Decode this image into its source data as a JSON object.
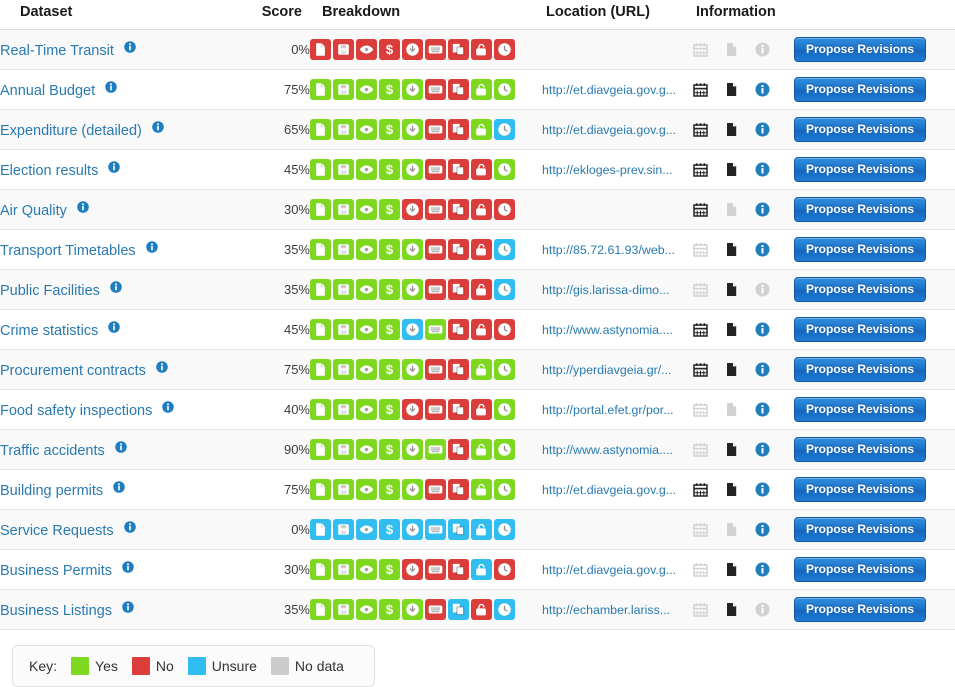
{
  "table": {
    "columns": [
      {
        "key": "dataset",
        "label": "Dataset"
      },
      {
        "key": "score",
        "label": "Score"
      },
      {
        "key": "breakdown",
        "label": "Breakdown"
      },
      {
        "key": "url",
        "label": "Location (URL)"
      },
      {
        "key": "information",
        "label": "Information"
      },
      {
        "key": "action",
        "label": ""
      }
    ],
    "action_label": "Propose Revisions",
    "breakdown_icon_names": [
      "file-icon",
      "floppy-disk-icon",
      "eye-icon",
      "dollar-icon",
      "download-icon",
      "keyboard-icon",
      "copy-icon",
      "unlock-icon",
      "clock-icon"
    ],
    "information_icon_names": [
      "calendar-icon",
      "document-icon",
      "info-circle-icon"
    ],
    "rows": [
      {
        "dataset": "Real-Time Transit",
        "score": "0%",
        "breakdown": [
          "no",
          "no",
          "no",
          "no",
          "no",
          "no",
          "no",
          "no",
          "no"
        ],
        "url": "",
        "information": [
          "off",
          "off",
          "off"
        ]
      },
      {
        "dataset": "Annual Budget",
        "score": "75%",
        "breakdown": [
          "yes",
          "yes",
          "yes",
          "yes",
          "yes",
          "no",
          "no",
          "yes",
          "yes"
        ],
        "url": "http://et.diavgeia.gov.g...",
        "information": [
          "on",
          "on",
          "on"
        ]
      },
      {
        "dataset": "Expenditure (detailed)",
        "score": "65%",
        "breakdown": [
          "yes",
          "yes",
          "yes",
          "yes",
          "yes",
          "no",
          "no",
          "yes",
          "unsure"
        ],
        "url": "http://et.diavgeia.gov.g...",
        "information": [
          "on",
          "on",
          "on"
        ]
      },
      {
        "dataset": "Election results",
        "score": "45%",
        "breakdown": [
          "yes",
          "yes",
          "yes",
          "yes",
          "yes",
          "no",
          "no",
          "no",
          "yes"
        ],
        "url": "http://ekloges-prev.sin...",
        "information": [
          "on",
          "on",
          "on"
        ]
      },
      {
        "dataset": "Air Quality",
        "score": "30%",
        "breakdown": [
          "yes",
          "yes",
          "yes",
          "yes",
          "no",
          "no",
          "no",
          "no",
          "no"
        ],
        "url": "",
        "information": [
          "on",
          "off",
          "on"
        ]
      },
      {
        "dataset": "Transport Timetables",
        "score": "35%",
        "breakdown": [
          "yes",
          "yes",
          "yes",
          "yes",
          "yes",
          "no",
          "no",
          "no",
          "unsure"
        ],
        "url": "http://85.72.61.93/web...",
        "information": [
          "off",
          "on",
          "on"
        ]
      },
      {
        "dataset": "Public Facilities",
        "score": "35%",
        "breakdown": [
          "yes",
          "yes",
          "yes",
          "yes",
          "yes",
          "no",
          "no",
          "no",
          "unsure"
        ],
        "url": "http://gis.larissa-dimo...",
        "information": [
          "off",
          "on",
          "off"
        ]
      },
      {
        "dataset": "Crime statistics",
        "score": "45%",
        "breakdown": [
          "yes",
          "yes",
          "yes",
          "yes",
          "unsure",
          "yes",
          "no",
          "no",
          "no"
        ],
        "url": "http://www.astynomia....",
        "information": [
          "on",
          "on",
          "on"
        ]
      },
      {
        "dataset": "Procurement contracts",
        "score": "75%",
        "breakdown": [
          "yes",
          "yes",
          "yes",
          "yes",
          "yes",
          "no",
          "no",
          "yes",
          "yes"
        ],
        "url": "http://yperdiavgeia.gr/...",
        "information": [
          "on",
          "on",
          "on"
        ]
      },
      {
        "dataset": "Food safety inspections",
        "score": "40%",
        "breakdown": [
          "yes",
          "yes",
          "yes",
          "yes",
          "no",
          "no",
          "no",
          "no",
          "yes"
        ],
        "url": "http://portal.efet.gr/por...",
        "information": [
          "off",
          "off",
          "on"
        ]
      },
      {
        "dataset": "Traffic accidents",
        "score": "90%",
        "breakdown": [
          "yes",
          "yes",
          "yes",
          "yes",
          "yes",
          "yes",
          "no",
          "yes",
          "yes"
        ],
        "url": "http://www.astynomia....",
        "information": [
          "off",
          "on",
          "on"
        ]
      },
      {
        "dataset": "Building permits",
        "score": "75%",
        "breakdown": [
          "yes",
          "yes",
          "yes",
          "yes",
          "yes",
          "no",
          "no",
          "yes",
          "yes"
        ],
        "url": "http://et.diavgeia.gov.g...",
        "information": [
          "on",
          "on",
          "on"
        ]
      },
      {
        "dataset": "Service Requests",
        "score": "0%",
        "breakdown": [
          "unsure",
          "unsure",
          "unsure",
          "unsure",
          "unsure",
          "unsure",
          "unsure",
          "unsure",
          "unsure"
        ],
        "url": "",
        "information": [
          "off",
          "off",
          "on"
        ]
      },
      {
        "dataset": "Business Permits",
        "score": "30%",
        "breakdown": [
          "yes",
          "yes",
          "yes",
          "yes",
          "no",
          "no",
          "no",
          "unsure",
          "no"
        ],
        "url": "http://et.diavgeia.gov.g...",
        "information": [
          "off",
          "on",
          "on"
        ]
      },
      {
        "dataset": "Business Listings",
        "score": "35%",
        "breakdown": [
          "yes",
          "yes",
          "yes",
          "yes",
          "yes",
          "no",
          "unsure",
          "no",
          "unsure"
        ],
        "url": "http://echamber.lariss...",
        "information": [
          "off",
          "on",
          "off"
        ]
      }
    ]
  },
  "key": {
    "label": "Key:",
    "items": [
      {
        "state": "yes",
        "label": "Yes",
        "color": "#7fd820"
      },
      {
        "state": "no",
        "label": "No",
        "color": "#db3e3a"
      },
      {
        "state": "unsure",
        "label": "Unsure",
        "color": "#32bdf0"
      },
      {
        "state": "nodata",
        "label": "No data",
        "color": "#cccccc"
      }
    ]
  },
  "colors": {
    "yes": "#7fd820",
    "no": "#db3e3a",
    "unsure": "#32bdf0",
    "nodata": "#cccccc",
    "link": "#2a7ab0",
    "button": "#1b6fc6",
    "info_on": "#1f7ec0",
    "info_off": "#cfcfcf"
  }
}
